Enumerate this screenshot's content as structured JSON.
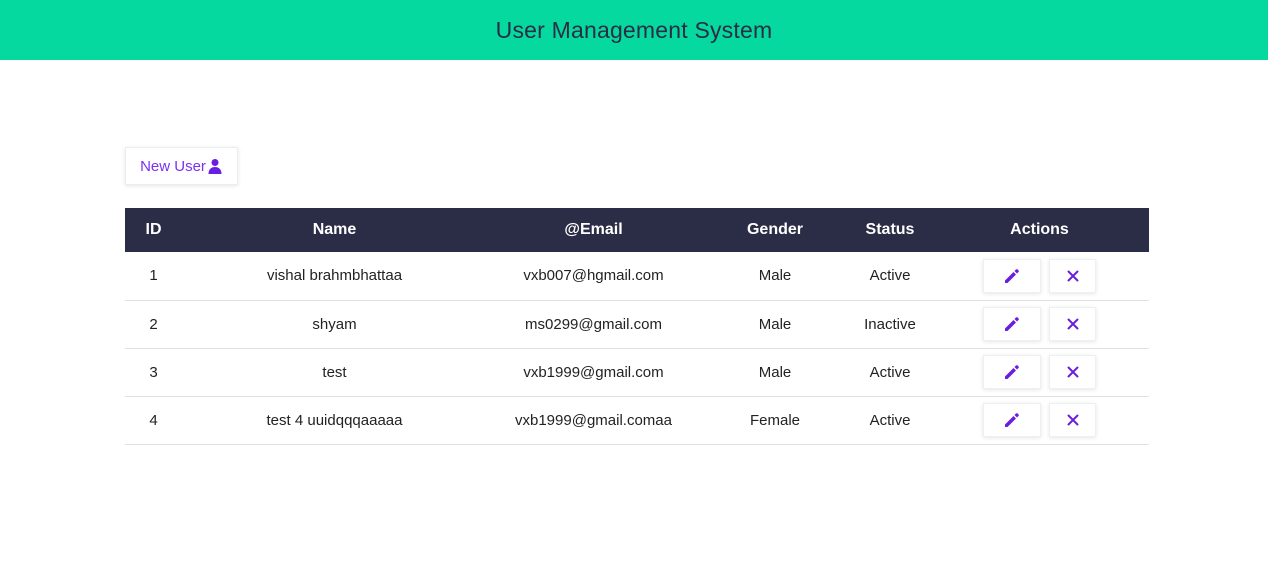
{
  "header": {
    "title": "User Management System"
  },
  "toolbar": {
    "new_user_label": "New User",
    "new_user_icon": "user-icon"
  },
  "table": {
    "columns": [
      "ID",
      "Name",
      "@Email",
      "Gender",
      "Status",
      "Actions"
    ],
    "rows": [
      {
        "id": "1",
        "name": "vishal brahmbhattaa",
        "email": "vxb007@hgmail.com",
        "gender": "Male",
        "status": "Active"
      },
      {
        "id": "2",
        "name": "shyam",
        "email": "ms0299@gmail.com",
        "gender": "Male",
        "status": "Inactive"
      },
      {
        "id": "3",
        "name": "test",
        "email": "vxb1999@gmail.com",
        "gender": "Male",
        "status": "Active"
      },
      {
        "id": "4",
        "name": "test 4 uuidqqqaaaaa",
        "email": "vxb1999@gmail.comaa",
        "gender": "Female",
        "status": "Active"
      }
    ],
    "row_actions": {
      "edit_icon": "pencil-icon",
      "delete_icon": "close-icon"
    }
  },
  "colors": {
    "header_bg": "#06d9a0",
    "header_text": "#2a2e45",
    "table_header_bg": "#2a2d45",
    "accent": "#7b2ff2"
  }
}
